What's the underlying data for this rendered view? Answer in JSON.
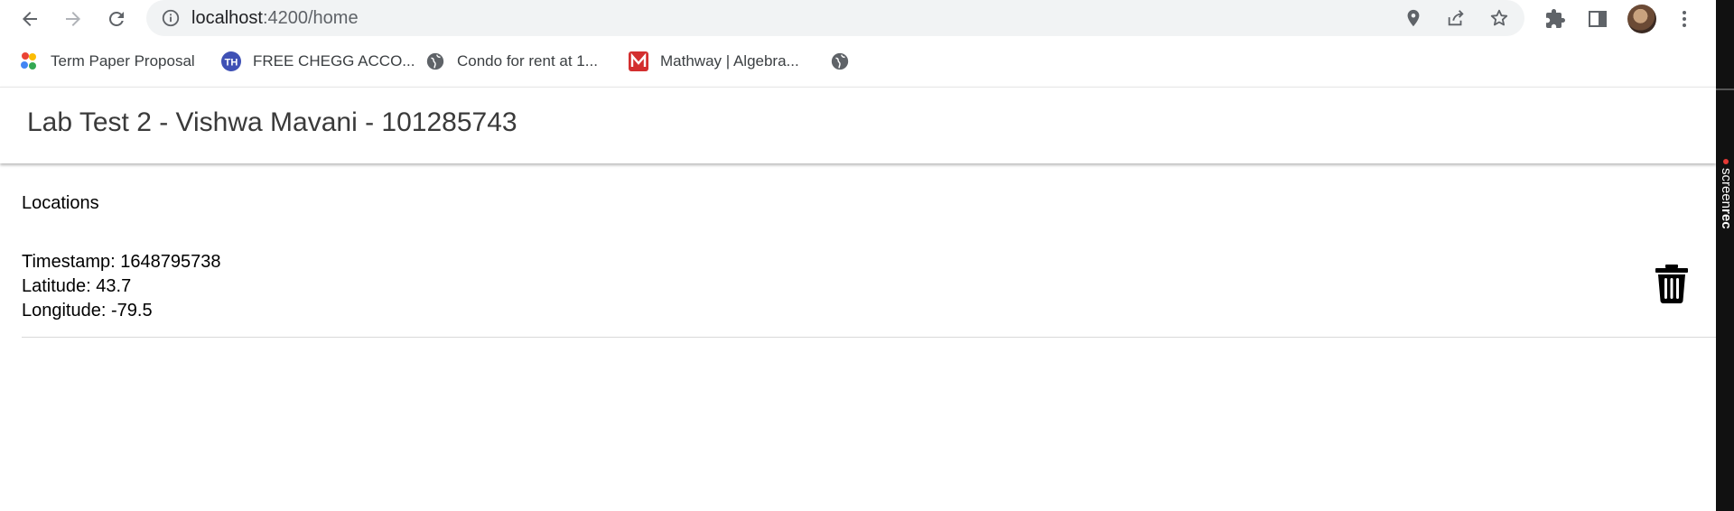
{
  "browser": {
    "url_host": "localhost",
    "url_path": ":4200/home",
    "bookmarks": [
      {
        "label": "Term Paper Proposal",
        "icon": "google-drive-icon"
      },
      {
        "label": "FREE CHEGG ACCO...",
        "icon": "th-site-icon"
      },
      {
        "label": "Condo for rent at 1...",
        "icon": "globe-icon"
      },
      {
        "label": "Mathway | Algebra...",
        "icon": "mathway-icon"
      },
      {
        "label": "",
        "icon": "globe-icon"
      }
    ]
  },
  "app": {
    "title": "Lab Test 2 - Vishwa Mavani - 101285743",
    "section_title": "Locations",
    "locations": [
      {
        "timestamp": "Timestamp: 1648795738",
        "latitude": "Latitude: 43.7",
        "longitude": "Longitude: -79.5"
      }
    ]
  },
  "overlay": {
    "brand_light": "screen",
    "brand_bold": "rec"
  }
}
